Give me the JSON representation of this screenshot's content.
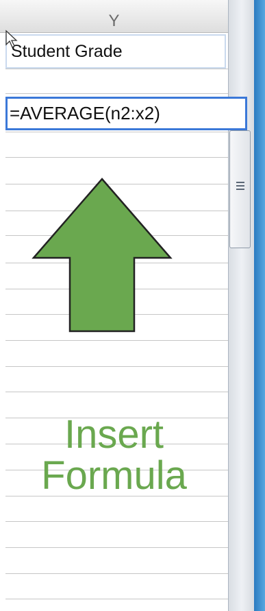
{
  "spreadsheet": {
    "column_header": "Y",
    "header_cell": "Student Grade",
    "formula_cell": "=AVERAGE(n2:x2)"
  },
  "annotation": {
    "line1": "Insert",
    "line2": "Formula",
    "arrow_color": "#6aa84f",
    "text_color": "#6aa84f"
  },
  "colors": {
    "selection_border": "#3b78d8",
    "gridline": "#c6c6c6"
  }
}
